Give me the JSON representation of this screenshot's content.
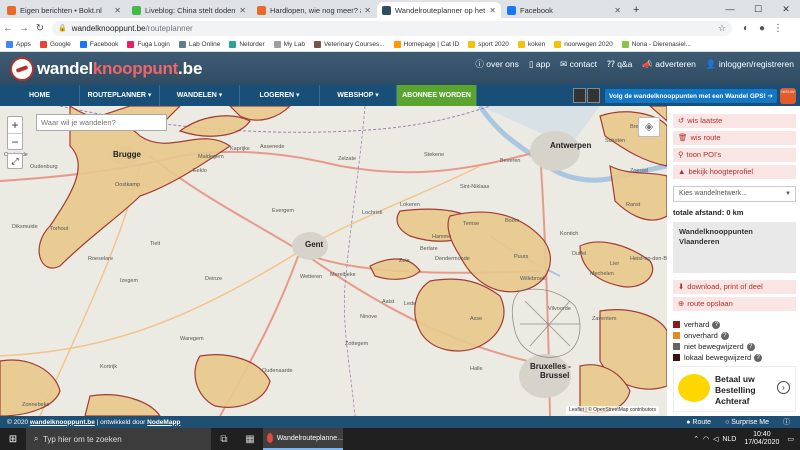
{
  "browser": {
    "tabs": [
      {
        "title": "Eigen berichten • Bokt.nl",
        "color": "#e86a2b"
      },
      {
        "title": "Liveblog: China stelt dodental na",
        "color": "#44bb44"
      },
      {
        "title": "Hardlopen, wie nog meer? #4 •",
        "color": "#e86a2b"
      },
      {
        "title": "Wandelrouteplanner op het wand",
        "color": "#2f4c63"
      },
      {
        "title": "Facebook",
        "color": "#1877f2"
      }
    ],
    "new_tab": "+",
    "url_host": "wandelknooppunt.be",
    "url_path": "/routeplanner"
  },
  "bookmarks": [
    {
      "label": "Apps",
      "color": "#4285f4"
    },
    {
      "label": "Google",
      "color": "#ea4335"
    },
    {
      "label": "Facebook",
      "color": "#1877f2"
    },
    {
      "label": "Fuga Login",
      "color": "#e91e63"
    },
    {
      "label": "Lab Online",
      "color": "#607d8b"
    },
    {
      "label": "Netorder",
      "color": "#26a69a"
    },
    {
      "label": "My Lab",
      "color": "#9e9e9e"
    },
    {
      "label": "Veterinary Courses...",
      "color": "#795548"
    },
    {
      "label": "Homepage | Cat ID",
      "color": "#ff9800"
    },
    {
      "label": "sport 2020",
      "color": "#f4c20d"
    },
    {
      "label": "koken",
      "color": "#f4c20d"
    },
    {
      "label": "noorwegen 2020",
      "color": "#f4c20d"
    },
    {
      "label": "Nona - Dierenasiel...",
      "color": "#8bc34a"
    }
  ],
  "site": {
    "logo_a": "wandel",
    "logo_b": "knooppunt",
    "logo_c": ".be",
    "toplinks": [
      "over ons",
      "app",
      "contact",
      "q&a",
      "adverteren",
      "inloggen/registreren"
    ],
    "nav": [
      "HOME",
      "ROUTEPLANNER ▾",
      "WANDELEN ▾",
      "LOGEREN ▾",
      "WEBSHOP ▾",
      "ABONNEE WORDEN"
    ],
    "gps_text": "Volg de wandelknooppunten met een Wandel GPS!",
    "promo": "NIEUW"
  },
  "map": {
    "search_placeholder": "Waar wil je wandelen?",
    "zoom_in": "+",
    "zoom_out": "−",
    "attribution": "Leaflet | © OpenStreetMap contributors",
    "cities": [
      "Brugge",
      "Gent",
      "Antwerpen",
      "Brussel",
      "Bruxelles -"
    ],
    "towns": [
      "Oostende",
      "Oudenburg",
      "Oostkamp",
      "Eeklo",
      "Maldegem",
      "Zelzate",
      "Stekene",
      "Sint-Niklaas",
      "Beveren",
      "Temse",
      "Lokeren",
      "Dendermonde",
      "Aalst",
      "Ninove",
      "Zottegem",
      "Oudenaarde",
      "Deinze",
      "Tielt",
      "Roeselare",
      "Torhout",
      "Diksmuide",
      "Kortrijk",
      "Waregem",
      "Izegem",
      "Lede",
      "Wetteren",
      "Merelbeke",
      "Mechelen",
      "Boom",
      "Kontich",
      "Lier",
      "Duffel",
      "Vilvoorde",
      "Zaventem",
      "Asse",
      "Halle",
      "Zonnebeke",
      "Kaprijke",
      "Assenede",
      "Evergem",
      "Lochristi",
      "Hamme",
      "Puurs",
      "Willebroek",
      "Zele",
      "Berlare",
      "Schoten",
      "Brecht",
      "Zoersel",
      "Ranst",
      "Heist-op-den-Berg"
    ]
  },
  "sidebar": {
    "buttons": [
      "wis laatste",
      "wis route",
      "toon POI's",
      "bekijk hoogteprofiel"
    ],
    "network_select": "Kies wandelnetwerk...",
    "total_distance": "totale afstand: 0 km",
    "network_box": "Wandelknooppunten Vlaanderen",
    "download": "download, print of deel",
    "save": "route opslaan",
    "legend": [
      {
        "label": "verhard",
        "color": "#8b1a1a"
      },
      {
        "label": "onverhard",
        "color": "#e08a2b"
      },
      {
        "label": "niet bewegwijzerd",
        "color": "#666666"
      },
      {
        "label": "lokaal bewegwijzerd",
        "color": "#3a1414"
      }
    ],
    "ad": "Betaal uw Bestelling Achteraf"
  },
  "footer": {
    "prefix": "© 2020",
    "site": "wandelknooppunt.be",
    "mid": "| ontwikkeld door",
    "dev": "NodeMapp",
    "route": "Route",
    "surprise": "Surprise Me"
  },
  "taskbar": {
    "search": "Typ hier om te zoeken",
    "app": "Wandelrouteplanne...",
    "lang": "NLD",
    "time": "10:40",
    "date": "17/04/2020"
  }
}
